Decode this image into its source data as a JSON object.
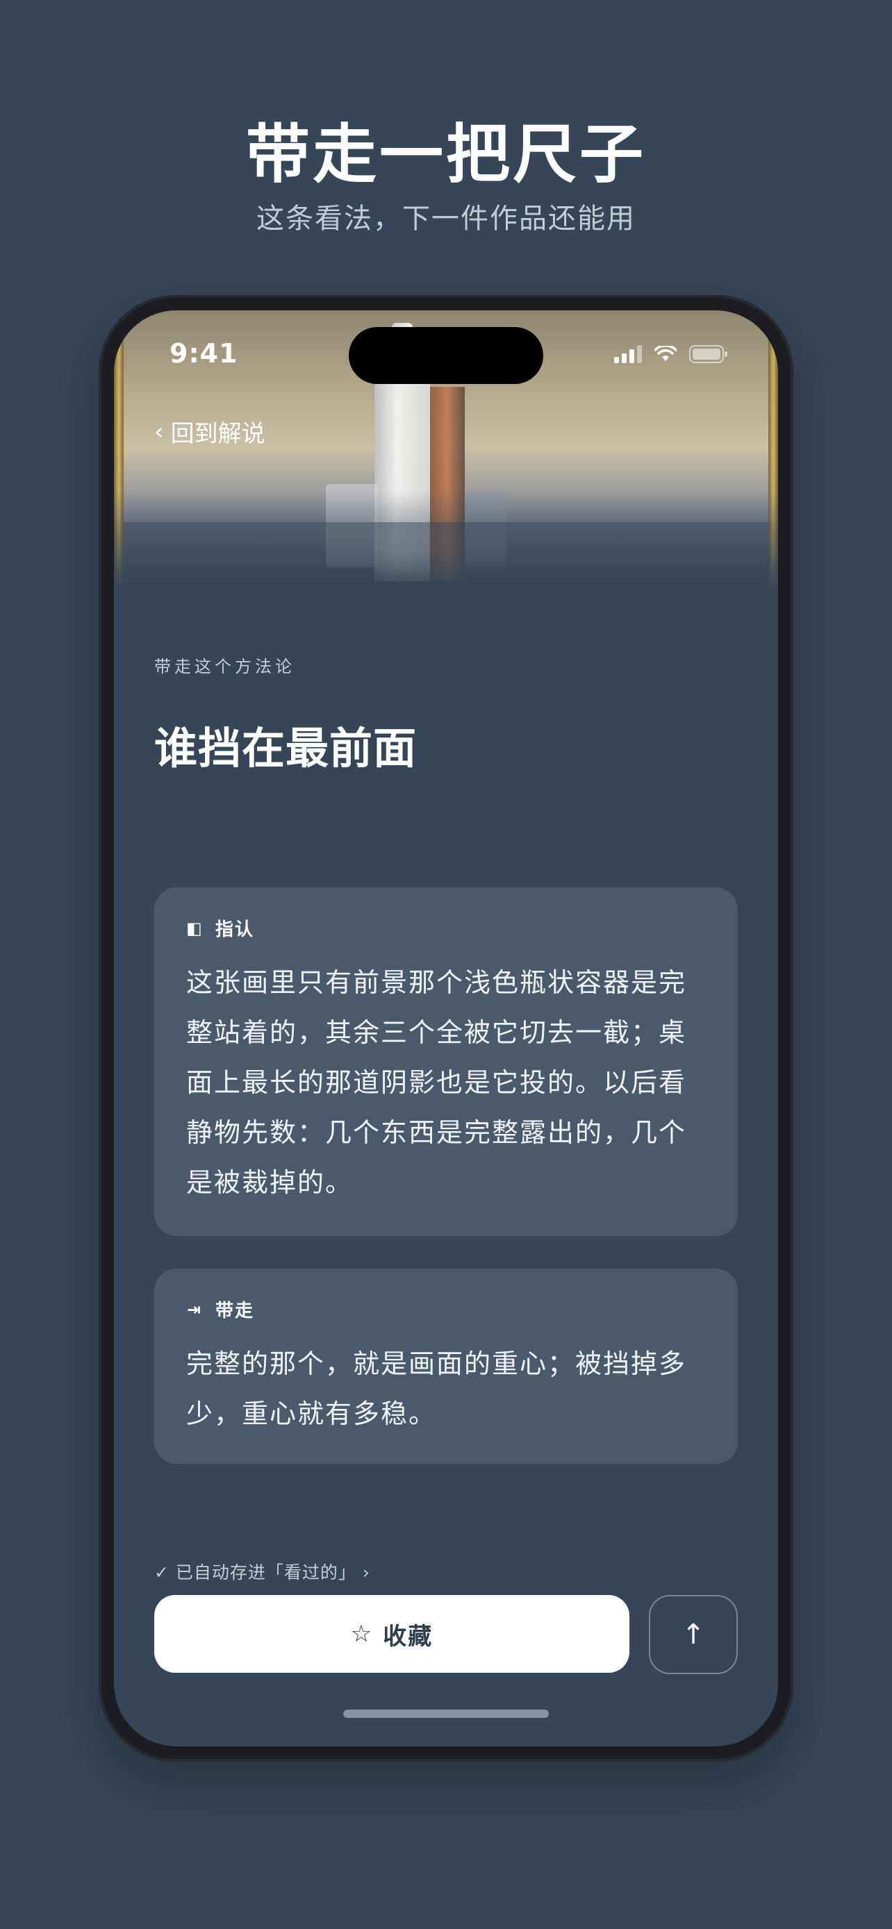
{
  "hero": {
    "title": "带走一把尺子",
    "subtitle": "这条看法，下一件作品还能用"
  },
  "status_bar": {
    "time": "9:41",
    "icons": [
      "signal-icon",
      "wifi-icon",
      "battery-icon"
    ]
  },
  "nav": {
    "back_icon": "‹",
    "back_label": "回到解说"
  },
  "section": {
    "kicker": "带走这个方法论",
    "title": "谁挡在最前面"
  },
  "cards": [
    {
      "icon": "◧",
      "label": "指认",
      "body": "这张画里只有前景那个浅色瓶状容器是完整站着的，其余三个全被它切去一截；桌面上最长的那道阴影也是它投的。以后看静物先数：几个东西是完整露出的，几个是被裁掉的。"
    },
    {
      "icon": "⇥",
      "label": "带走",
      "body": "完整的那个，就是画面的重心；被挡掉多少，重心就有多稳。"
    }
  ],
  "footer": {
    "autosave_note": "✓ 已自动存进「看过的」 ›",
    "save_icon": "☆",
    "save_label": "收藏",
    "up_icon": "↑"
  },
  "colors": {
    "background": "#354659",
    "card": "#4a5a6c",
    "button": "#ffffff",
    "button_text": "#2f3d4d"
  }
}
